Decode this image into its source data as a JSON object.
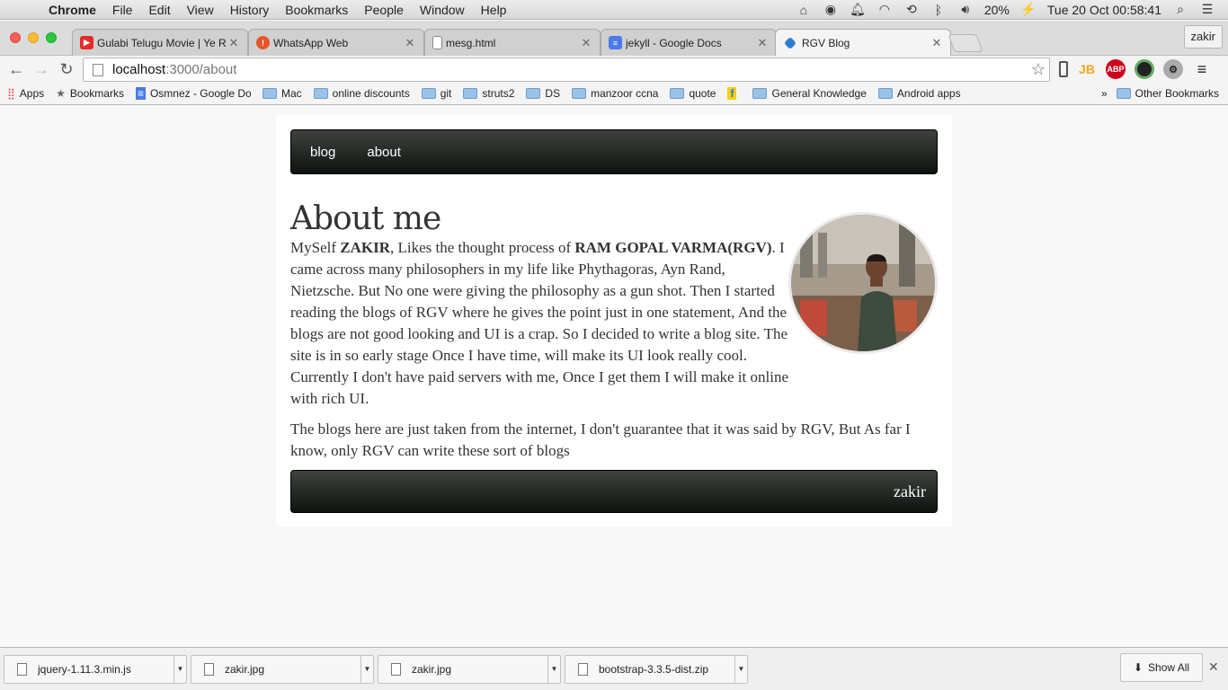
{
  "menubar": {
    "app_name": "Chrome",
    "items": [
      "File",
      "Edit",
      "View",
      "History",
      "Bookmarks",
      "People",
      "Window",
      "Help"
    ],
    "battery": "20%",
    "clock": "Tue 20 Oct  00:58:41"
  },
  "tabs": [
    {
      "title": "Gulabi Telugu Movie | Ye R",
      "favicon": "youtube-icon",
      "color": "#e52d27"
    },
    {
      "title": "WhatsApp Web",
      "favicon": "whatsapp-icon",
      "color": "#e8552b"
    },
    {
      "title": "mesg.html",
      "favicon": "document-icon",
      "color": "#ffffff"
    },
    {
      "title": "jekyll - Google Docs",
      "favicon": "google-docs-icon",
      "color": "#4a7be8"
    },
    {
      "title": "RGV Blog",
      "favicon": "blog-icon",
      "color": "#2d7dd2"
    }
  ],
  "profile_name": "zakir",
  "omnibox": {
    "host": "localhost",
    "path": ":3000/about"
  },
  "bookmarks": {
    "items": [
      {
        "label": "Apps",
        "icon": "apps-grid-icon"
      },
      {
        "label": "Bookmarks",
        "icon": "star-icon"
      },
      {
        "label": "Osmnez - Google Do",
        "icon": "google-docs-icon"
      },
      {
        "label": "Mac",
        "icon": "folder-icon"
      },
      {
        "label": "online discounts",
        "icon": "folder-icon"
      },
      {
        "label": "git",
        "icon": "folder-icon"
      },
      {
        "label": "struts2",
        "icon": "folder-icon"
      },
      {
        "label": "DS",
        "icon": "folder-icon"
      },
      {
        "label": "manzoor ccna",
        "icon": "folder-icon"
      },
      {
        "label": "quote",
        "icon": "folder-icon"
      },
      {
        "label": "",
        "icon": "flipkart-icon"
      },
      {
        "label": "General Knowledge",
        "icon": "folder-icon"
      },
      {
        "label": "Android apps",
        "icon": "folder-icon"
      }
    ],
    "overflow": "»",
    "other": "Other Bookmarks"
  },
  "site": {
    "nav": [
      "blog",
      "about"
    ],
    "title": "About me",
    "para1_prefix": "MySelf ",
    "para1_name": "ZAKIR",
    "para1_mid": ", Likes the thought process of ",
    "para1_rgv": "RAM GOPAL VARMA(RGV)",
    "para1_rest": ". I came across many philosophers in my life like Phythagoras, Ayn Rand, Nietzsche. But No one were giving the philosophy as a gun shot. Then I started reading the blogs of RGV where he gives the point just in one statement, And the blogs are not good looking and UI is a crap. So I decided to write a blog site. The site is in so early stage Once I have time, will make its UI look really cool. Currently I don't have paid servers with me, Once I get them I will make it online with rich UI.",
    "para2": "The blogs here are just taken from the internet, I don't guarantee that it was said by RGV, But As far I know, only RGV can write these sort of blogs",
    "footer_name": "zakir"
  },
  "downloads": {
    "items": [
      "jquery-1.11.3.min.js",
      "zakir.jpg",
      "zakir.jpg",
      "bootstrap-3.3.5-dist.zip"
    ],
    "show_all": "Show All"
  }
}
